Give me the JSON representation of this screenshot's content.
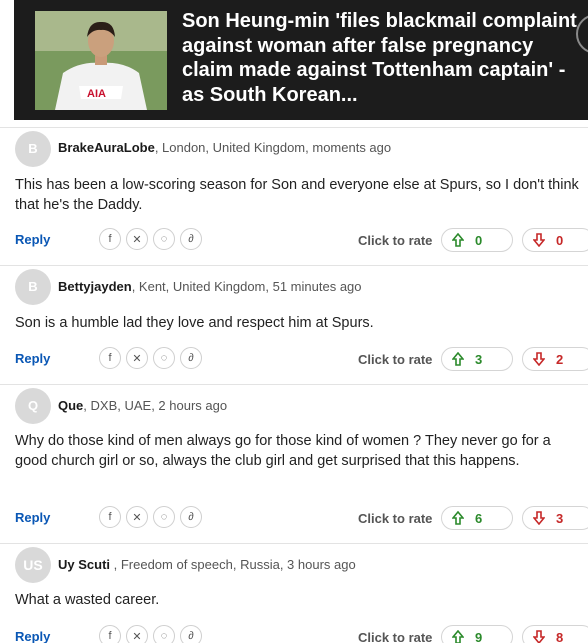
{
  "article": {
    "title": "Son Heung-min 'files blackmail complaint against woman after false pregnancy claim made against Tottenham captain' - as South Korean..."
  },
  "rate_label": "Click to rate",
  "reply_label": "Reply",
  "share_icons": [
    "facebook-icon",
    "x-icon",
    "whatsapp-icon",
    "link-icon"
  ],
  "comments": [
    {
      "initials": "B",
      "user": "BrakeAuraLobe",
      "details": ", London, United Kingdom, moments ago",
      "text": "This has been a low-scoring season for Son and everyone else at Spurs, so I don't think that he's the Daddy.",
      "up": "0",
      "down": "0"
    },
    {
      "initials": "B",
      "user": "Bettyjayden",
      "details": ", Kent, United Kingdom, 51 minutes ago",
      "text": "Son is a humble lad they love and respect him at Spurs.",
      "up": "3",
      "down": "2"
    },
    {
      "initials": "Q",
      "user": "Que",
      "details": ", DXB, UAE, 2 hours ago",
      "text": "Why do those kind of men always go for those kind of women ? They never go for a good church girl or so, always the club girl and get surprised that this happens.",
      "up": "6",
      "down": "3"
    },
    {
      "initials": "US",
      "user": "Uy Scuti",
      "details": " , Freedom of speech, Russia, 3 hours ago",
      "text": "What a wasted career.",
      "up": "9",
      "down": "8"
    }
  ],
  "colors": {
    "banner_bg": "#1c1c1c",
    "reply_link": "#0a57b5",
    "upvote": "#2b8a2b",
    "downvote": "#c62828",
    "avatar_bg": "#d9d9d9"
  }
}
